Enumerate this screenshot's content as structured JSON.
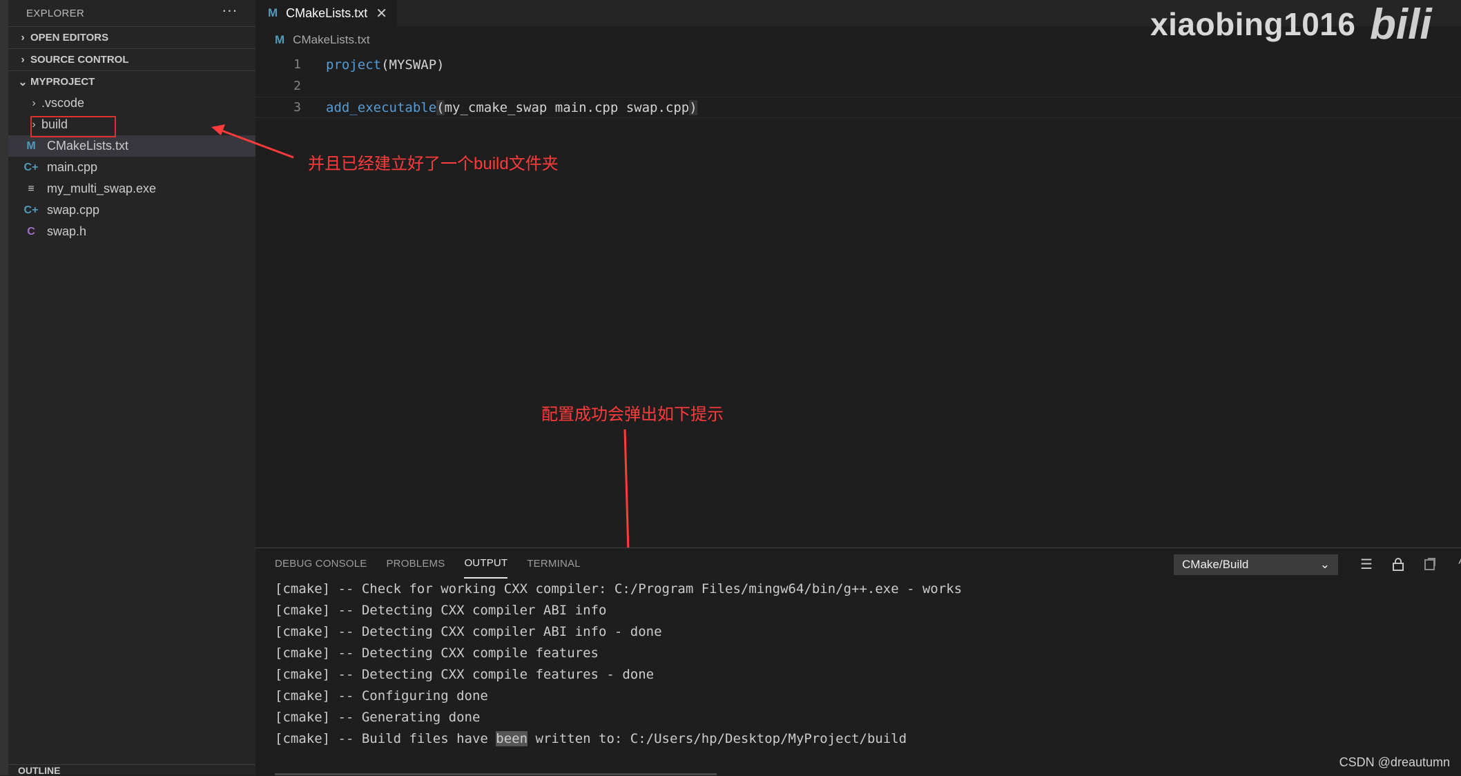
{
  "sidebar": {
    "header": "EXPLORER",
    "more": "···",
    "sections": {
      "open_editors": "OPEN EDITORS",
      "source_control": "SOURCE CONTROL",
      "myproject": "MYPROJECT",
      "outline": "OUTLINE"
    },
    "tree": [
      {
        "label": ".vscode",
        "kind": "folder",
        "icon": "chevron-right-icon"
      },
      {
        "label": "build",
        "kind": "folder",
        "icon": "chevron-right-icon"
      },
      {
        "label": "CMakeLists.txt",
        "kind": "file",
        "icon": "cmake-file-icon",
        "glyph": "M"
      },
      {
        "label": "main.cpp",
        "kind": "file",
        "icon": "cpp-file-icon",
        "glyph": "C+"
      },
      {
        "label": "my_multi_swap.exe",
        "kind": "file",
        "icon": "exe-file-icon",
        "glyph": "≡"
      },
      {
        "label": "swap.cpp",
        "kind": "file",
        "icon": "cpp-file-icon",
        "glyph": "C+"
      },
      {
        "label": "swap.h",
        "kind": "file",
        "icon": "c-header-icon",
        "glyph": "C"
      }
    ]
  },
  "editor": {
    "tab": {
      "label": "CMakeLists.txt",
      "glyph": "M",
      "close": "✕"
    },
    "breadcrumb": {
      "label": "CMakeLists.txt",
      "glyph": "M"
    },
    "lines": [
      {
        "n": "1",
        "kw": "project",
        "rest": "(MYSWAP)"
      },
      {
        "n": "2",
        "kw": "",
        "rest": ""
      },
      {
        "n": "3",
        "kw": "add_executable",
        "paren": "(",
        "rest": "my_cmake_swap main.cpp swap.cpp",
        "close": ")"
      }
    ]
  },
  "watermark": {
    "user": "xiaobing1016",
    "logo": "bili"
  },
  "annotations": {
    "build_folder": "并且已经建立好了一个build文件夹",
    "config_success": "配置成功会弹出如下提示"
  },
  "panel": {
    "tabs": [
      "DEBUG CONSOLE",
      "PROBLEMS",
      "OUTPUT",
      "TERMINAL"
    ],
    "active_tab": "OUTPUT",
    "channel": "CMake/Build",
    "output_lines": [
      "[cmake] -- Check for working CXX compiler: C:/Program Files/mingw64/bin/g++.exe - works",
      "[cmake] -- Detecting CXX compiler ABI info",
      "[cmake] -- Detecting CXX compiler ABI info - done",
      "[cmake] -- Detecting CXX compile features",
      "[cmake] -- Detecting CXX compile features - done",
      "[cmake] -- Configuring done",
      "[cmake] -- Generating done"
    ],
    "last_line": {
      "before": "[cmake] -- Build files have ",
      "selected": "been",
      "after": " written to: C:/Users/hp/Desktop/MyProject/build"
    }
  },
  "credit": "CSDN @dreautumn",
  "colors": {
    "annotation": "#ff3b3b",
    "accent": "#519aba",
    "background": "#1e1e1e"
  }
}
